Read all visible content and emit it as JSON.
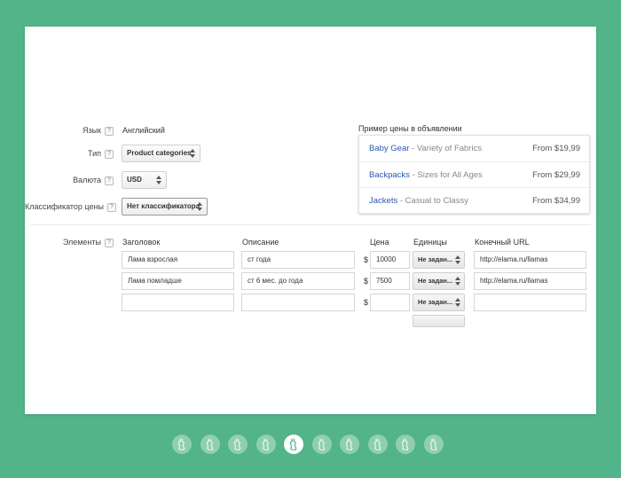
{
  "form": {
    "language_label": "Язык",
    "language_value": "Английский",
    "type_label": "Тип",
    "type_value": "Product categories",
    "currency_label": "Валюта",
    "currency_value": "USD",
    "classifier_label": "Классификатор цены",
    "classifier_value": "Нет классификатора",
    "help_glyph": "?"
  },
  "preview": {
    "title": "Пример цены в объявлении",
    "rows": [
      {
        "headline": "Baby Gear",
        "separator": " - ",
        "description": "Variety of Fabrics",
        "price": "From $19,99"
      },
      {
        "headline": "Backpacks",
        "separator": " - ",
        "description": "Sizes for All Ages",
        "price": "From $29,99"
      },
      {
        "headline": "Jackets",
        "separator": " - ",
        "description": "Casual to Classy",
        "price": "From $34,99"
      }
    ]
  },
  "elements": {
    "label": "Элементы",
    "columns": {
      "headline": "Заголовок",
      "description": "Описание",
      "price": "Цена",
      "unit": "Единицы",
      "url": "Конечный URL"
    },
    "currency_symbol": "$",
    "rows": [
      {
        "headline": "Лама взрослая",
        "description": "ст года",
        "price": "10000",
        "unit": "Не задан...",
        "url": "http://elama.ru/llamas"
      },
      {
        "headline": "Лама помладше",
        "description": "ст 6 мес. до года",
        "price": "7500",
        "unit": "Не задан...",
        "url": "http://elama.ru/llamas"
      },
      {
        "headline": "",
        "description": "",
        "price": "",
        "unit": "Не задан...",
        "url": ""
      }
    ]
  },
  "pagination": {
    "total": 10,
    "active_index": 5,
    "icon": "llama-icon"
  }
}
